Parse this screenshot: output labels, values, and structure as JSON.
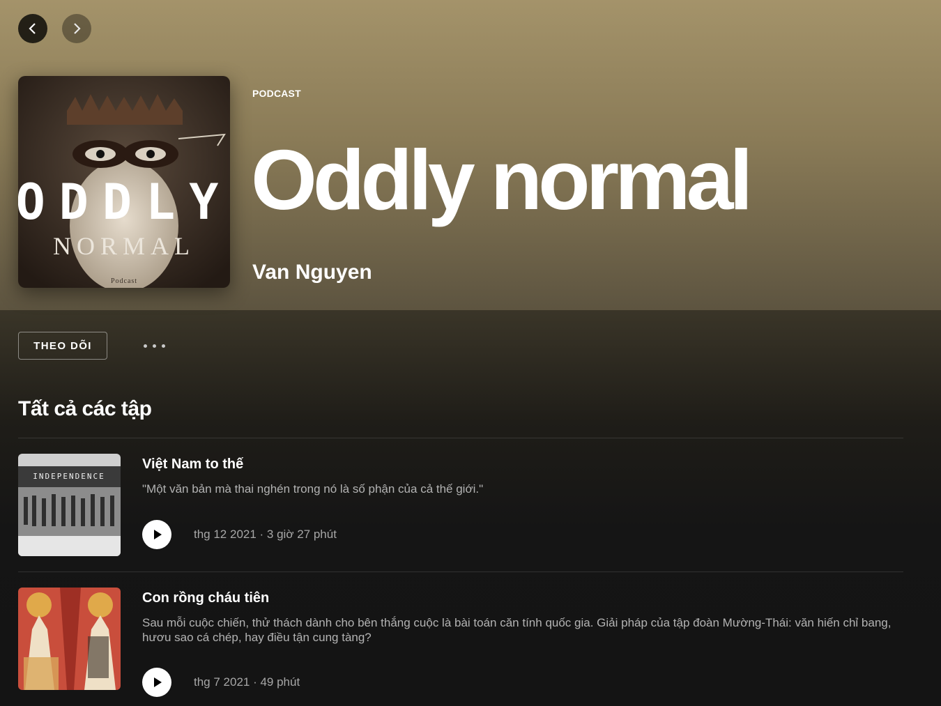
{
  "nav": {
    "back_icon": "chevron-left-icon",
    "forward_icon": "chevron-right-icon"
  },
  "show": {
    "kind": "PODCAST",
    "title": "Oddly normal",
    "author": "Van Nguyen",
    "cover_text": {
      "line1": "ODDLY",
      "line2": "NORMAL",
      "line3": "Podcast"
    }
  },
  "actions": {
    "follow_label": "THEO DÕI",
    "more_icon": "more-horizontal-icon"
  },
  "episodes_section": {
    "title": "Tất cả các tập",
    "episodes": [
      {
        "title": "Việt Nam to thế",
        "description": "\"Một văn bản mà thai nghén trong nó là số phận của cả thế giới.\"",
        "meta": "thg 12 2021 · 3 giờ 27 phút",
        "thumb_text": "INDEPENDENCE"
      },
      {
        "title": "Con rồng cháu tiên",
        "description": "Sau mỗi cuộc chiến, thử thách dành cho bên thắng cuộc là bài toán căn tính quốc gia. Giải pháp của tập đoàn Mường-Thái: văn hiến chỉ bang, hươu sao cá chép, hay điều tận cung tàng?",
        "meta": "thg 7 2021 ·  49 phút"
      }
    ]
  },
  "colors": {
    "hero_top": "#a4936a",
    "background": "#151515",
    "accent": "#ffffff"
  }
}
